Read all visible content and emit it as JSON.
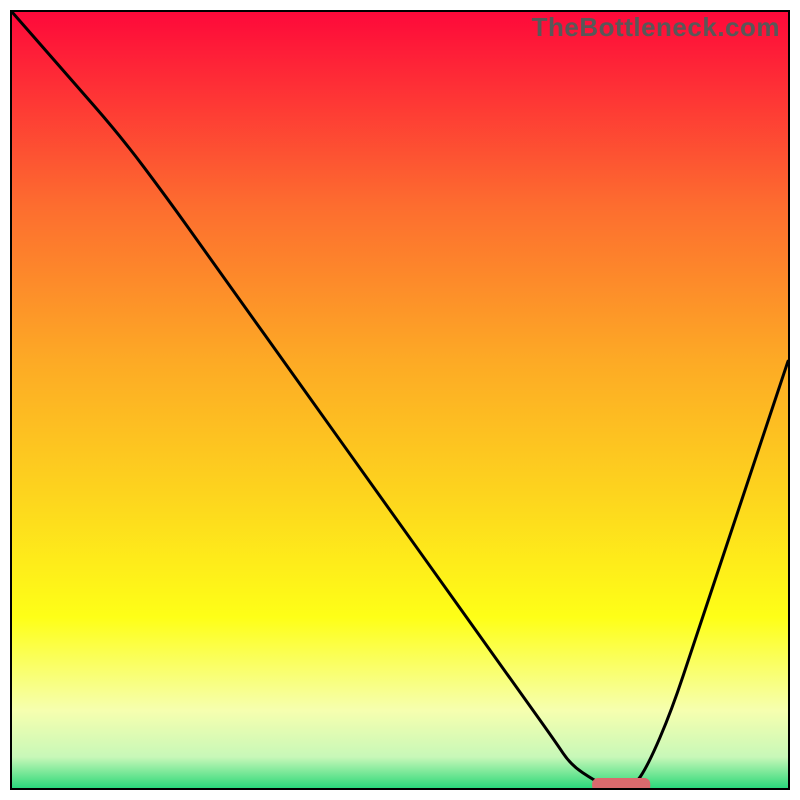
{
  "watermark": "TheBottleneck.com",
  "colors": {
    "gradient_top": "#fe093a",
    "gradient_mid_upper": "#fd8d2a",
    "gradient_mid": "#fdd41e",
    "gradient_mid_lower": "#feff17",
    "gradient_pale": "#f6ffaf",
    "gradient_green": "#2bd97d",
    "curve": "#000000",
    "marker": "#d96a6d",
    "frame": "#000000"
  },
  "chart_data": {
    "type": "line",
    "title": "",
    "xlabel": "",
    "ylabel": "",
    "xlim": [
      0,
      100
    ],
    "ylim": [
      0,
      100
    ],
    "x": [
      0,
      7,
      14,
      20,
      25,
      30,
      35,
      40,
      45,
      50,
      55,
      60,
      65,
      70,
      72,
      75,
      77,
      80,
      82,
      85,
      88,
      92,
      96,
      100
    ],
    "y": [
      100,
      92,
      84,
      76,
      69,
      62,
      55,
      48,
      41,
      34,
      27,
      20,
      13,
      6,
      3,
      1,
      0,
      0,
      3,
      10,
      19,
      31,
      43,
      55
    ],
    "marker": {
      "x_center": 78.5,
      "width": 7.5,
      "y": 0.4
    },
    "annotations": []
  }
}
